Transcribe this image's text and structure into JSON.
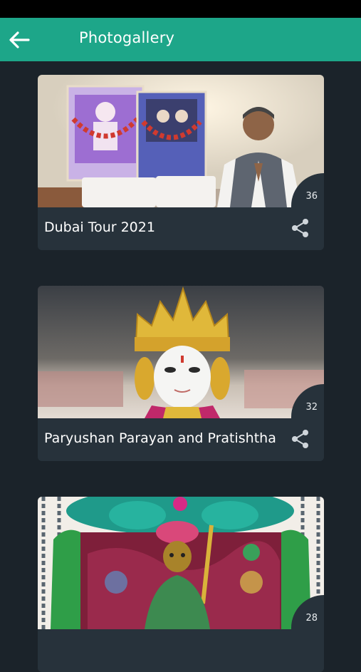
{
  "header": {
    "title": "Photogallery"
  },
  "albums": [
    {
      "title": "Dubai Tour 2021",
      "count": "36"
    },
    {
      "title": "Paryushan Parayan and Pratishtha",
      "count": "32"
    },
    {
      "title": "",
      "count": "28"
    }
  ],
  "icons": {
    "back": "arrow-left-icon",
    "share": "share-icon"
  },
  "colors": {
    "accent": "#1da689",
    "background": "#1b232a",
    "card": "#27323b"
  }
}
